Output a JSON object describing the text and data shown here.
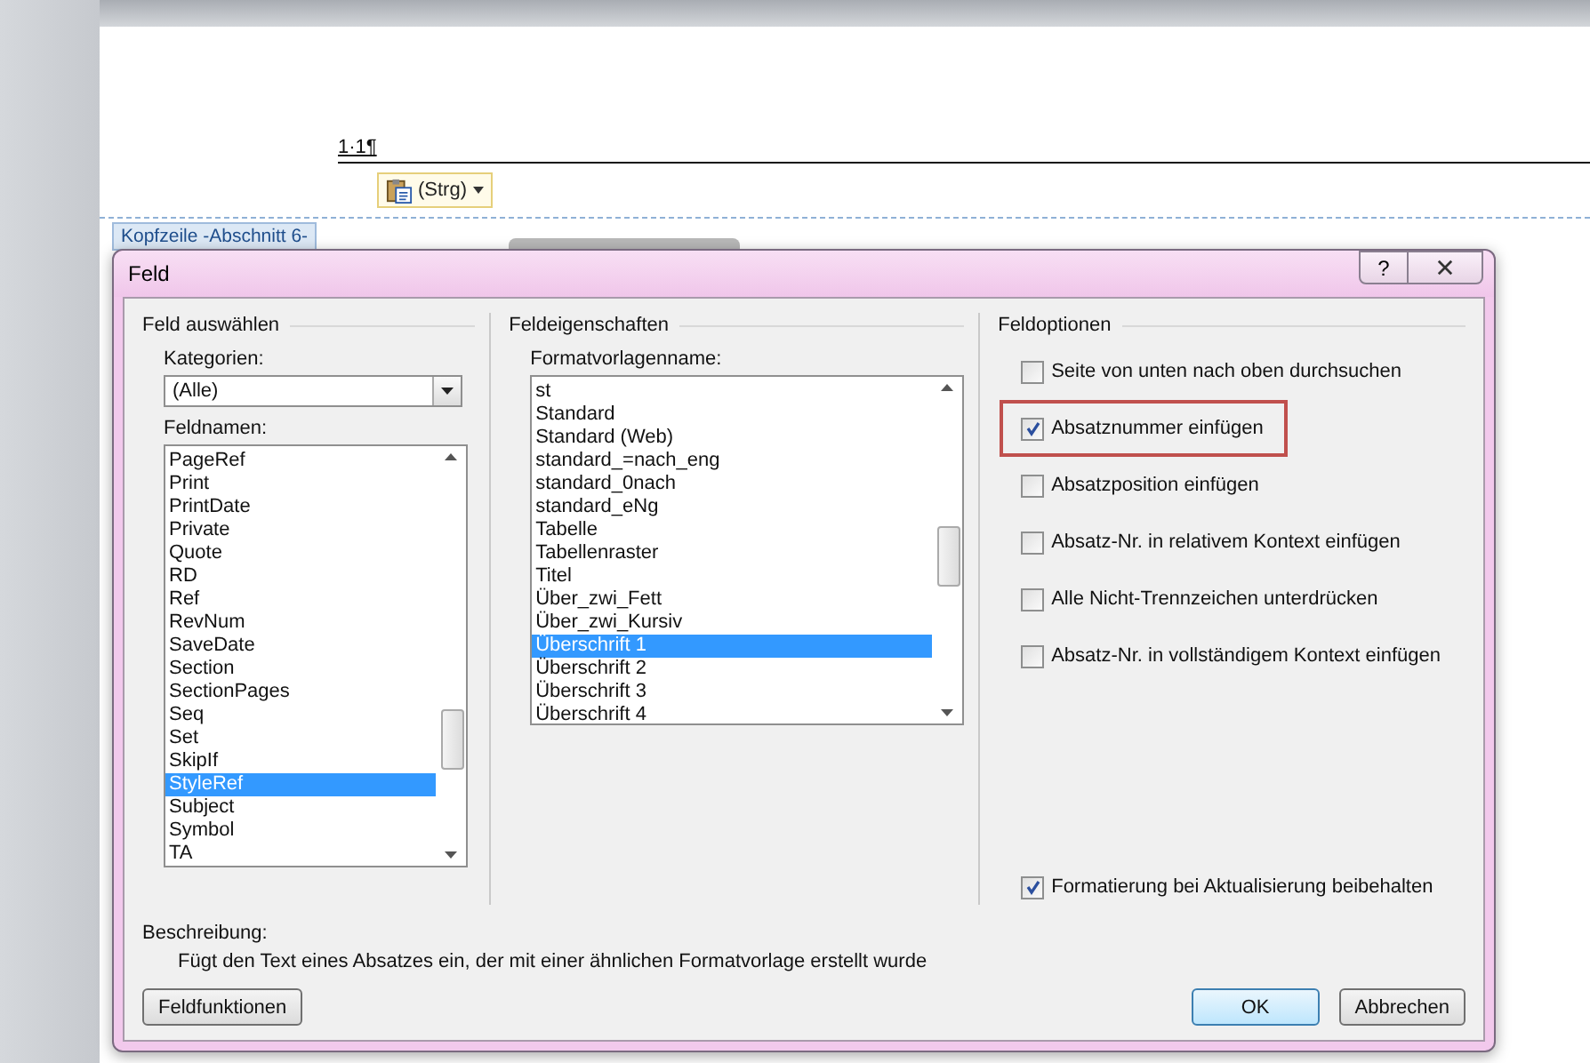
{
  "document": {
    "header_text": "1·1¶",
    "paste_label": "(Strg)",
    "header_tab": "Kopfzeile -Abschnitt 6-"
  },
  "dialog": {
    "title": "Feld",
    "help": "?",
    "select_field": {
      "title": "Feld auswählen",
      "categories_label": "Kategorien:",
      "category": "(Alle)",
      "names_label": "Feldnamen:",
      "names": [
        {
          "label": "PageRef",
          "selected": false
        },
        {
          "label": "Print",
          "selected": false
        },
        {
          "label": "PrintDate",
          "selected": false
        },
        {
          "label": "Private",
          "selected": false
        },
        {
          "label": "Quote",
          "selected": false
        },
        {
          "label": "RD",
          "selected": false
        },
        {
          "label": "Ref",
          "selected": false
        },
        {
          "label": "RevNum",
          "selected": false
        },
        {
          "label": "SaveDate",
          "selected": false
        },
        {
          "label": "Section",
          "selected": false
        },
        {
          "label": "SectionPages",
          "selected": false
        },
        {
          "label": "Seq",
          "selected": false
        },
        {
          "label": "Set",
          "selected": false
        },
        {
          "label": "SkipIf",
          "selected": false
        },
        {
          "label": "StyleRef",
          "selected": true
        },
        {
          "label": "Subject",
          "selected": false
        },
        {
          "label": "Symbol",
          "selected": false
        },
        {
          "label": "TA",
          "selected": false
        }
      ]
    },
    "properties": {
      "title": "Feldeigenschaften",
      "style_label": "Formatvorlagenname:",
      "styles": [
        {
          "label": "st",
          "selected": false
        },
        {
          "label": "Standard",
          "selected": false
        },
        {
          "label": "Standard (Web)",
          "selected": false
        },
        {
          "label": "standard_=nach_eng",
          "selected": false
        },
        {
          "label": "standard_0nach",
          "selected": false
        },
        {
          "label": "standard_eNg",
          "selected": false
        },
        {
          "label": "Tabelle",
          "selected": false
        },
        {
          "label": "Tabellenraster",
          "selected": false
        },
        {
          "label": "Titel",
          "selected": false
        },
        {
          "label": "Über_zwi_Fett",
          "selected": false
        },
        {
          "label": "Über_zwi_Kursiv",
          "selected": false
        },
        {
          "label": "Überschrift 1",
          "selected": true
        },
        {
          "label": "Überschrift 2",
          "selected": false
        },
        {
          "label": "Überschrift 3",
          "selected": false
        },
        {
          "label": "Überschrift 4",
          "selected": false
        }
      ]
    },
    "options": {
      "title": "Feldoptionen",
      "items": [
        {
          "label": "Seite von unten nach oben durchsuchen",
          "checked": false,
          "highlighted": false
        },
        {
          "label": "Absatznummer einfügen",
          "checked": true,
          "highlighted": true
        },
        {
          "label": "Absatzposition einfügen",
          "checked": false,
          "highlighted": false
        },
        {
          "label": "Absatz-Nr. in relativem Kontext einfügen",
          "checked": false,
          "highlighted": false
        },
        {
          "label": "Alle Nicht-Trennzeichen unterdrücken",
          "checked": false,
          "highlighted": false
        },
        {
          "label": "Absatz-Nr. in vollständigem Kontext einfügen",
          "checked": false,
          "highlighted": false
        }
      ],
      "keep_formatting": {
        "label": "Formatierung bei Aktualisierung beibehalten",
        "checked": true
      }
    },
    "description": {
      "label": "Beschreibung:",
      "text": "Fügt den Text eines Absatzes ein, der mit einer ähnlichen Formatvorlage erstellt wurde"
    },
    "buttons": {
      "field_codes": "Feldfunktionen",
      "ok": "OK",
      "cancel": "Abbrechen"
    }
  }
}
